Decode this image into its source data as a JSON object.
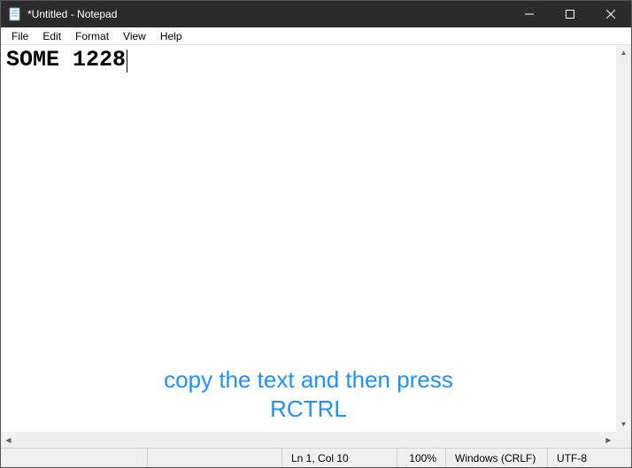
{
  "titlebar": {
    "title": "*Untitled - Notepad"
  },
  "menubar": {
    "items": [
      "File",
      "Edit",
      "Format",
      "View",
      "Help"
    ]
  },
  "editor": {
    "content": "SOME 1228"
  },
  "overlay": {
    "line1": "copy the text and then press",
    "line2": "RCTRL"
  },
  "statusbar": {
    "position": "Ln 1, Col 10",
    "zoom": "100%",
    "line_ending": "Windows (CRLF)",
    "encoding": "UTF-8"
  }
}
